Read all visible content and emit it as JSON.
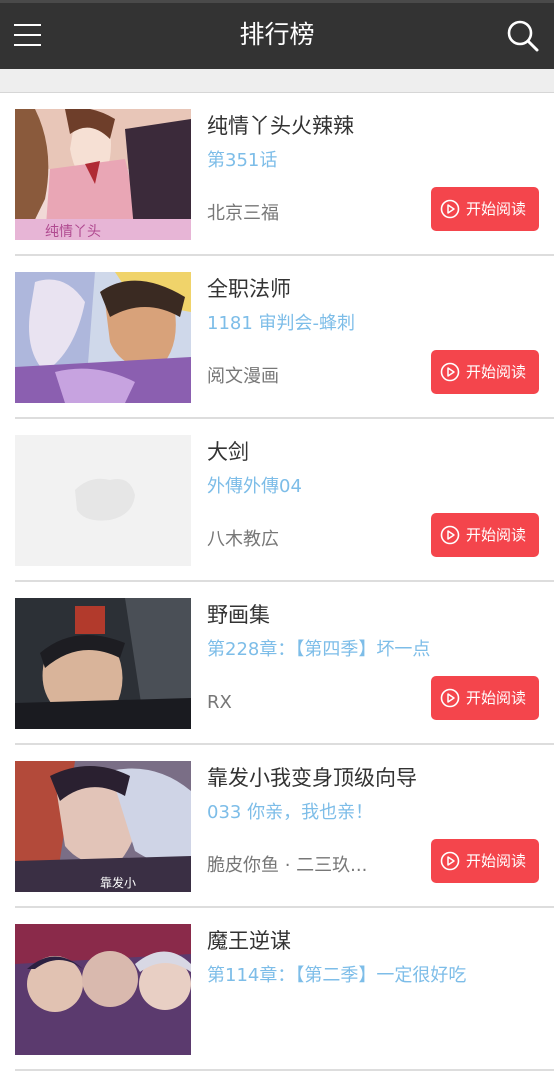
{
  "header": {
    "title": "排行榜",
    "menu_icon": "hamburger-menu-icon",
    "search_icon": "search-icon"
  },
  "list": {
    "read_button_label": "开始阅读",
    "items": [
      {
        "name": "纯情丫头火辣辣",
        "chapter": "第351话",
        "author": "北京三福"
      },
      {
        "name": "全职法师",
        "chapter": "1181 审判会-蜂刺",
        "author": "阅文漫画"
      },
      {
        "name": "大剑",
        "chapter": "外傳外傳04",
        "author": "八木教広"
      },
      {
        "name": "野画集",
        "chapter": "第228章：【第四季】坏一点",
        "author": "RX"
      },
      {
        "name": "靠发小我变身顶级向导",
        "chapter": "033 你亲，我也亲！",
        "author": "脆皮你鱼 · 二三玖..."
      },
      {
        "name": "魔王逆谋",
        "chapter": "第114章：【第二季】一定很好吃",
        "author": ""
      }
    ]
  },
  "colors": {
    "topbar": "#333333",
    "accent_button": "#f4454c",
    "chapter_text": "#7dbde8"
  }
}
